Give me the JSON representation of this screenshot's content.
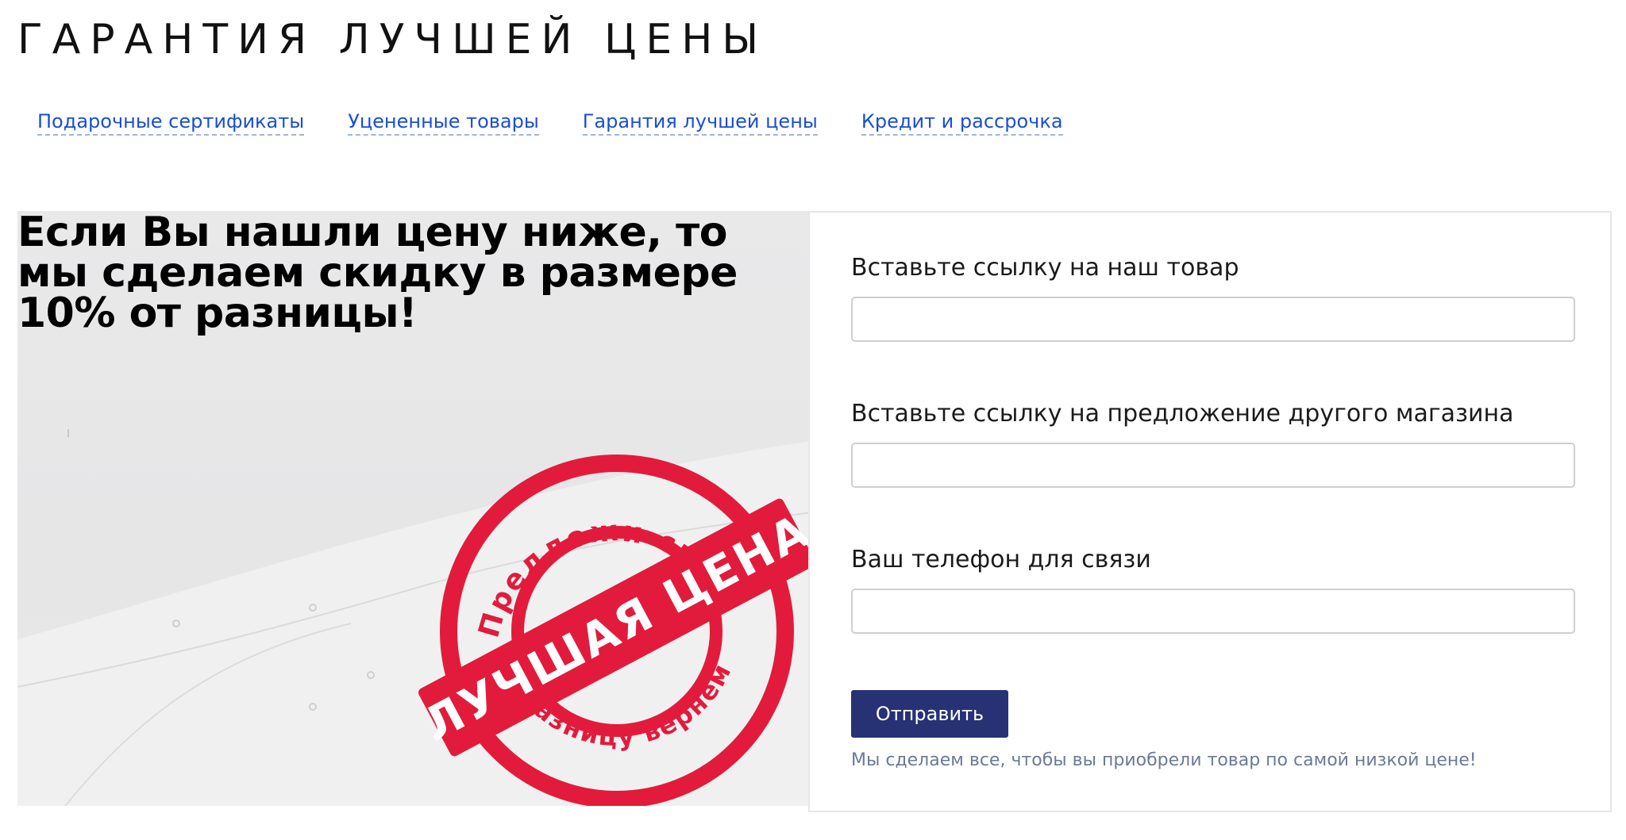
{
  "page": {
    "title": "ГАРАНТИЯ ЛУЧШЕЙ ЦЕНЫ"
  },
  "nav": {
    "items": [
      {
        "label": "Подарочные сертификаты"
      },
      {
        "label": "Уцененные товары"
      },
      {
        "label": "Гарантия лучшей цены"
      },
      {
        "label": "Кредит и рассрочка"
      }
    ]
  },
  "promo": {
    "heading": "Если Вы нашли цену ниже, то мы сделаем скидку в размере 10% от разницы!",
    "stamp": {
      "top_text": "Предложи свою",
      "band_text": "ЛУЧШАЯ ЦЕНА",
      "bottom_text": "разницу вернем"
    }
  },
  "form": {
    "fields": [
      {
        "label": "Вставьте ссылку на наш товар",
        "value": "",
        "placeholder": ""
      },
      {
        "label": "Вставьте ссылку на предложение другого магазина",
        "value": "",
        "placeholder": ""
      },
      {
        "label": "Ваш телефон для связи",
        "value": "",
        "placeholder": ""
      }
    ],
    "submit_label": "Отправить",
    "note": "Мы сделаем все, чтобы вы приобрели товар по самой низкой цене!"
  },
  "colors": {
    "link": "#1a4fd0",
    "button": "#263274",
    "stamp_red": "#e21b3c",
    "note": "#6b7a95"
  }
}
